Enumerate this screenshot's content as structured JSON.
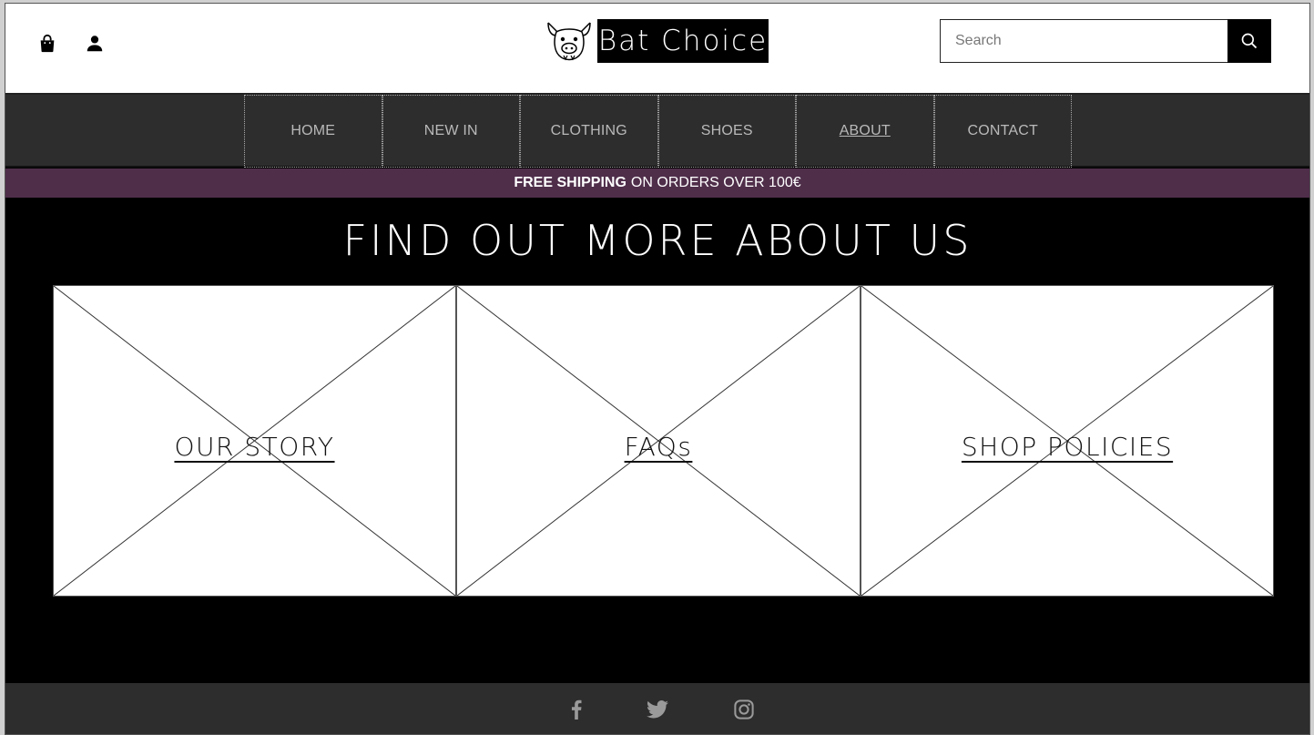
{
  "brand": {
    "name": "Bat Choice",
    "logo_icon": "pig-bat-icon"
  },
  "header": {
    "icons": [
      "shopping-bag-icon",
      "user-icon"
    ],
    "search": {
      "placeholder": "Search",
      "value": "",
      "button_icon": "search-icon"
    }
  },
  "nav": {
    "items": [
      {
        "label": "HOME",
        "active": false
      },
      {
        "label": "NEW IN",
        "active": false
      },
      {
        "label": "CLOTHING",
        "active": false
      },
      {
        "label": "SHOES",
        "active": false
      },
      {
        "label": "ABOUT",
        "active": true
      },
      {
        "label": "CONTACT",
        "active": false
      }
    ]
  },
  "banner": {
    "bold": "FREE SHIPPING",
    "text": "ON ORDERS OVER 100€"
  },
  "main": {
    "title": "FIND OUT MORE ABOUT US",
    "cards": [
      {
        "label": "OUR STORY"
      },
      {
        "label": "FAQs"
      },
      {
        "label": "SHOP POLICIES"
      }
    ]
  },
  "footer": {
    "social": [
      "facebook-icon",
      "twitter-icon",
      "instagram-icon"
    ]
  },
  "colors": {
    "header_bg": "#ffffff",
    "nav_bg": "#2d2d2d",
    "banner_bg": "#4f2e4a",
    "main_bg": "#000000",
    "footer_bg": "#2d2d2d",
    "nav_text": "#b9b9b9"
  }
}
